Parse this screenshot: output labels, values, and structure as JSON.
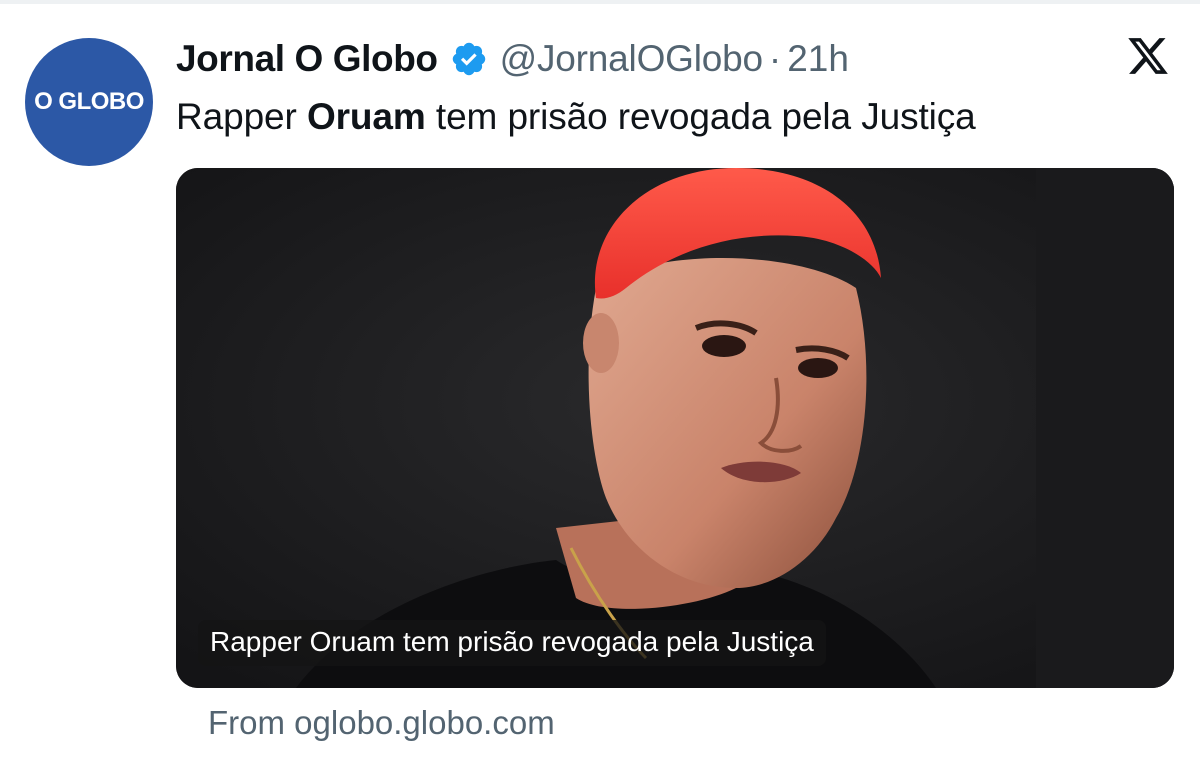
{
  "tweet": {
    "avatar_text": "O GLOBO",
    "display_name": "Jornal O Globo",
    "handle": "@JornalOGlobo",
    "separator": "·",
    "time": "21h",
    "text_prefix": "Rapper ",
    "text_bold": "Oruam",
    "text_suffix": " tem prisão revogada pela Justiça",
    "card": {
      "caption": "Rapper Oruam tem prisão revogada pela Justiça"
    },
    "source_prefix": "From ",
    "source_domain": "oglobo.globo.com"
  },
  "icons": {
    "verified": "verified-badge-icon",
    "platform": "x-logo-icon"
  },
  "colors": {
    "avatar_bg": "#2c58a6",
    "verified": "#1d9bf0",
    "secondary_text": "#536471"
  }
}
